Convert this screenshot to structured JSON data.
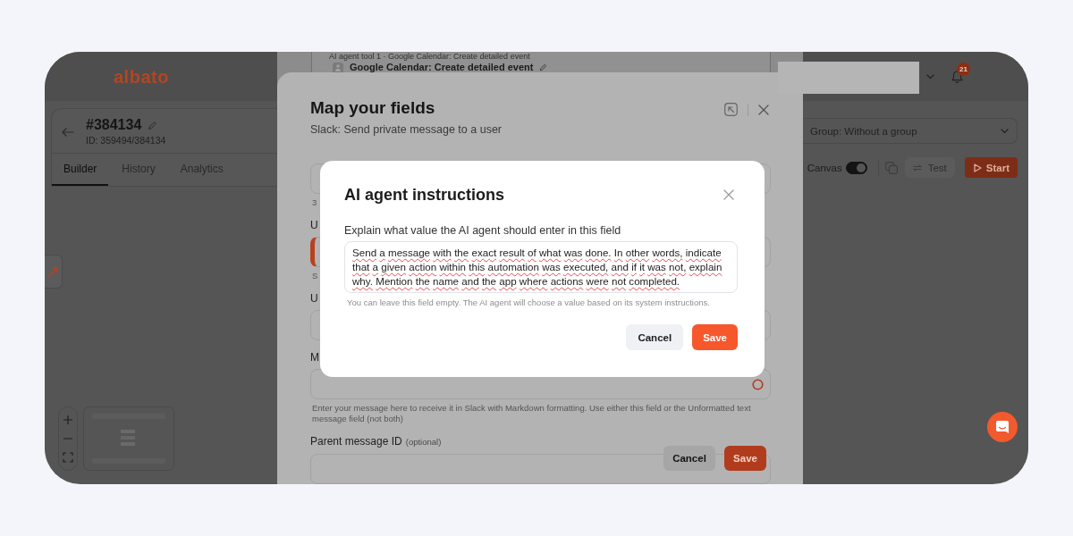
{
  "header": {
    "logo": "albato",
    "notification_count": "21"
  },
  "automation": {
    "name": "#384134",
    "id": "ID: 359494/384134"
  },
  "tabs": [
    {
      "label": "Builder",
      "selected": true
    },
    {
      "label": "History",
      "selected": false
    },
    {
      "label": "Analytics",
      "selected": false
    }
  ],
  "group_select": {
    "value": "Group: Without a group"
  },
  "toolbar": {
    "canvas_label": "Canvas",
    "canvas_on": true,
    "test_button": "Test",
    "start_button": "Start"
  },
  "tool_card": {
    "caption": "AI agent tool 1 · Google Calendar: Create detailed event",
    "title": "Google Calendar: Create detailed event"
  },
  "map_fields_dialog": {
    "title": "Map your fields",
    "subtitle": "Slack: Send private message to a user",
    "rows": [
      {
        "kind": "field",
        "highlighted": false,
        "ai_agent_on": false
      },
      {
        "kind": "hint",
        "text": "3"
      },
      {
        "kind": "label",
        "text": "U"
      },
      {
        "kind": "field",
        "highlighted": true,
        "ai_agent_on": false
      },
      {
        "kind": "hint",
        "text": "S"
      },
      {
        "kind": "label",
        "text": "U"
      },
      {
        "kind": "field",
        "highlighted": false,
        "ai_agent_on": false
      },
      {
        "kind": "label",
        "text": "M"
      },
      {
        "kind": "field",
        "highlighted": false,
        "ai_agent_on": true
      },
      {
        "kind": "hint",
        "text": "Enter your message here to receive it in Slack with Markdown formatting. Use either this field or the Unformatted text message field (not both)"
      },
      {
        "kind": "label",
        "text": "Parent message ID",
        "note": "(optional)"
      },
      {
        "kind": "field",
        "highlighted": false,
        "ai_agent_on": false
      }
    ],
    "cancel_button": "Cancel",
    "save_button": "Save"
  },
  "ai_instructions_dialog": {
    "title": "AI agent instructions",
    "label": "Explain what value the AI agent should enter in this field",
    "value": "Send a message with the exact result of what was done. In other words, indicate that a given action within this automation was executed, and if it was not, explain why. Mention the name and the app where actions were not completed.",
    "hint": "You can leave this field empty. The AI agent will choose a value based on its system instructions.",
    "cancel_button": "Cancel",
    "save_button": "Save"
  }
}
